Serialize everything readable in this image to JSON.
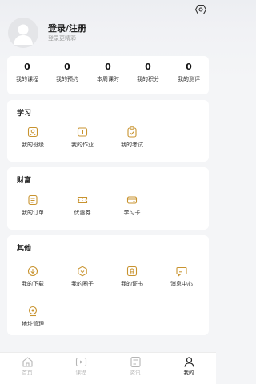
{
  "header": {
    "title": "登录/注册",
    "subtitle": "登录更精彩"
  },
  "stats": [
    {
      "value": "0",
      "label": "我的课程"
    },
    {
      "value": "0",
      "label": "我的预约"
    },
    {
      "value": "0",
      "label": "本周课时"
    },
    {
      "value": "0",
      "label": "我的积分"
    },
    {
      "value": "0",
      "label": "我的测评"
    }
  ],
  "study": {
    "title": "学习",
    "items": [
      {
        "label": "我的班级",
        "icon": "class-icon"
      },
      {
        "label": "我的作业",
        "icon": "homework-icon"
      },
      {
        "label": "我的考试",
        "icon": "exam-icon"
      }
    ]
  },
  "wealth": {
    "title": "财富",
    "items": [
      {
        "label": "我的订单",
        "icon": "order-icon"
      },
      {
        "label": "优惠券",
        "icon": "coupon-icon"
      },
      {
        "label": "学习卡",
        "icon": "study-card-icon"
      }
    ]
  },
  "other": {
    "title": "其他",
    "items": [
      {
        "label": "我的下载",
        "icon": "download-icon"
      },
      {
        "label": "我的圈子",
        "icon": "circle-icon"
      },
      {
        "label": "我的证书",
        "icon": "certificate-icon"
      },
      {
        "label": "消息中心",
        "icon": "message-icon"
      },
      {
        "label": "地址管理",
        "icon": "address-icon"
      }
    ]
  },
  "tabbar": [
    {
      "label": "首页",
      "icon": "home-icon",
      "active": false
    },
    {
      "label": "课程",
      "icon": "course-icon",
      "active": false
    },
    {
      "label": "资讯",
      "icon": "news-icon",
      "active": false
    },
    {
      "label": "我的",
      "icon": "profile-icon",
      "active": true
    }
  ],
  "colors": {
    "accent": "#c8932f",
    "background": "#f4f5f7",
    "card": "#ffffff",
    "tab_inactive": "#b5b5b5"
  }
}
